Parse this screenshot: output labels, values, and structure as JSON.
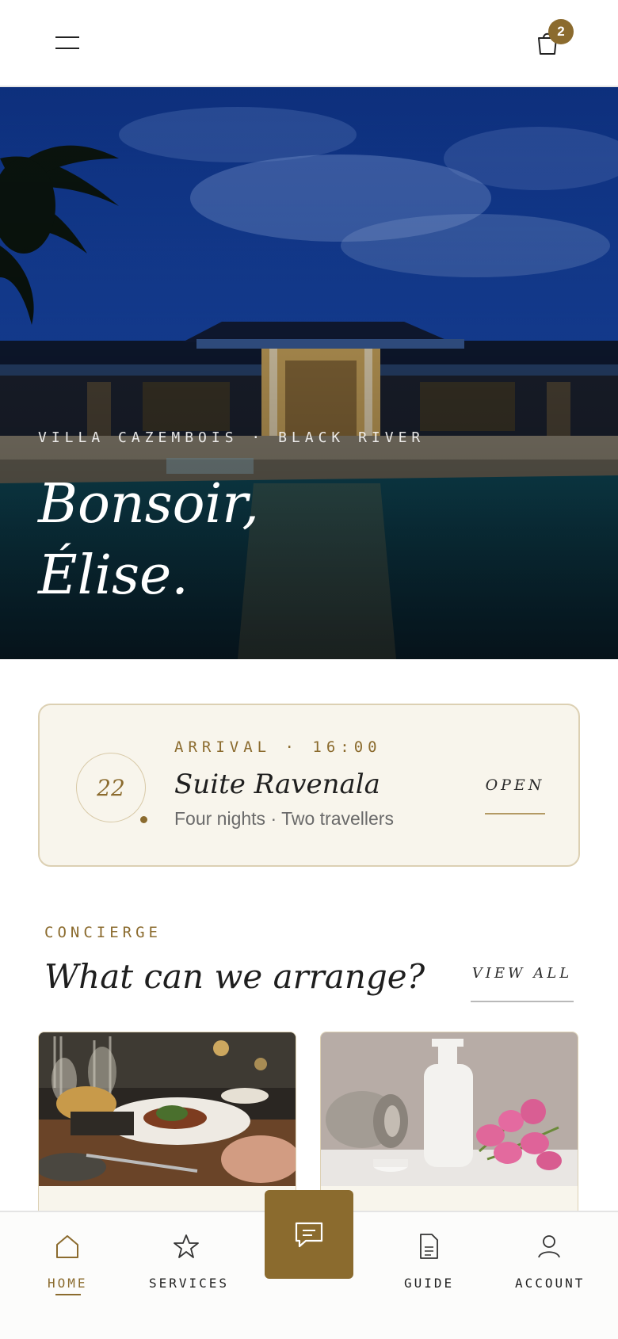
{
  "header": {
    "menu_icon": "hamburger-menu-icon",
    "bag_icon": "shopping-bag-icon",
    "bag_count": "2",
    "accent_color": "#8b6b2e"
  },
  "hero": {
    "location": "VILLA CAZEMBOIS · BLACK RIVER",
    "greeting_line1": "Bonsoir,",
    "greeting_line2": "Élise."
  },
  "booking": {
    "date": "22",
    "arrival": "ARRIVAL · 16:00",
    "suite": "Suite Ravenala",
    "details": "Four nights · Two travellers",
    "action": "OPEN"
  },
  "concierge": {
    "label": "CONCIERGE",
    "title": "What can we arrange?",
    "view_all": "VIEW ALL",
    "cards": [
      {
        "image": "fine-dining-photo"
      },
      {
        "image": "spa-towel-bottle-tulips-photo"
      }
    ]
  },
  "nav": {
    "items": [
      {
        "label": "HOME",
        "icon": "home-icon",
        "active": true
      },
      {
        "label": "SERVICES",
        "icon": "star-icon"
      },
      {
        "label": "GUIDE",
        "icon": "document-icon"
      },
      {
        "label": "ACCOUNT",
        "icon": "user-icon"
      }
    ],
    "chat_icon": "chat-bubble-icon"
  }
}
